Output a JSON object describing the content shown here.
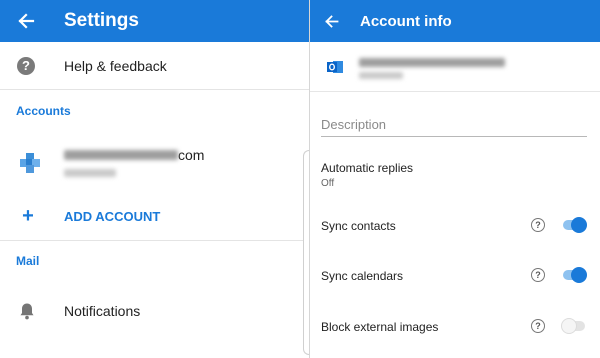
{
  "settings": {
    "title": "Settings",
    "help_label": "Help & feedback",
    "accounts_header": "Accounts",
    "account_email_suffix": "com",
    "add_account_label": "ADD ACCOUNT",
    "mail_header": "Mail",
    "notifications_label": "Notifications"
  },
  "account_info": {
    "title": "Account info",
    "description_placeholder": "Description",
    "automatic_replies_label": "Automatic replies",
    "automatic_replies_value": "Off",
    "sync_contacts_label": "Sync contacts",
    "sync_contacts_on": true,
    "sync_calendars_label": "Sync calendars",
    "sync_calendars_on": true,
    "block_images_label": "Block external images",
    "block_images_on": false,
    "help_glyph": "?"
  },
  "colors": {
    "accent": "#1a7ad9",
    "toggle_track_on": "#8ec2f0",
    "outlook_blue": "#0a64c8"
  },
  "icons": {
    "back": "arrow-left-icon",
    "help": "question-circle-icon",
    "add": "plus-icon",
    "notifications": "bell-icon",
    "account": "outlook-icon"
  }
}
